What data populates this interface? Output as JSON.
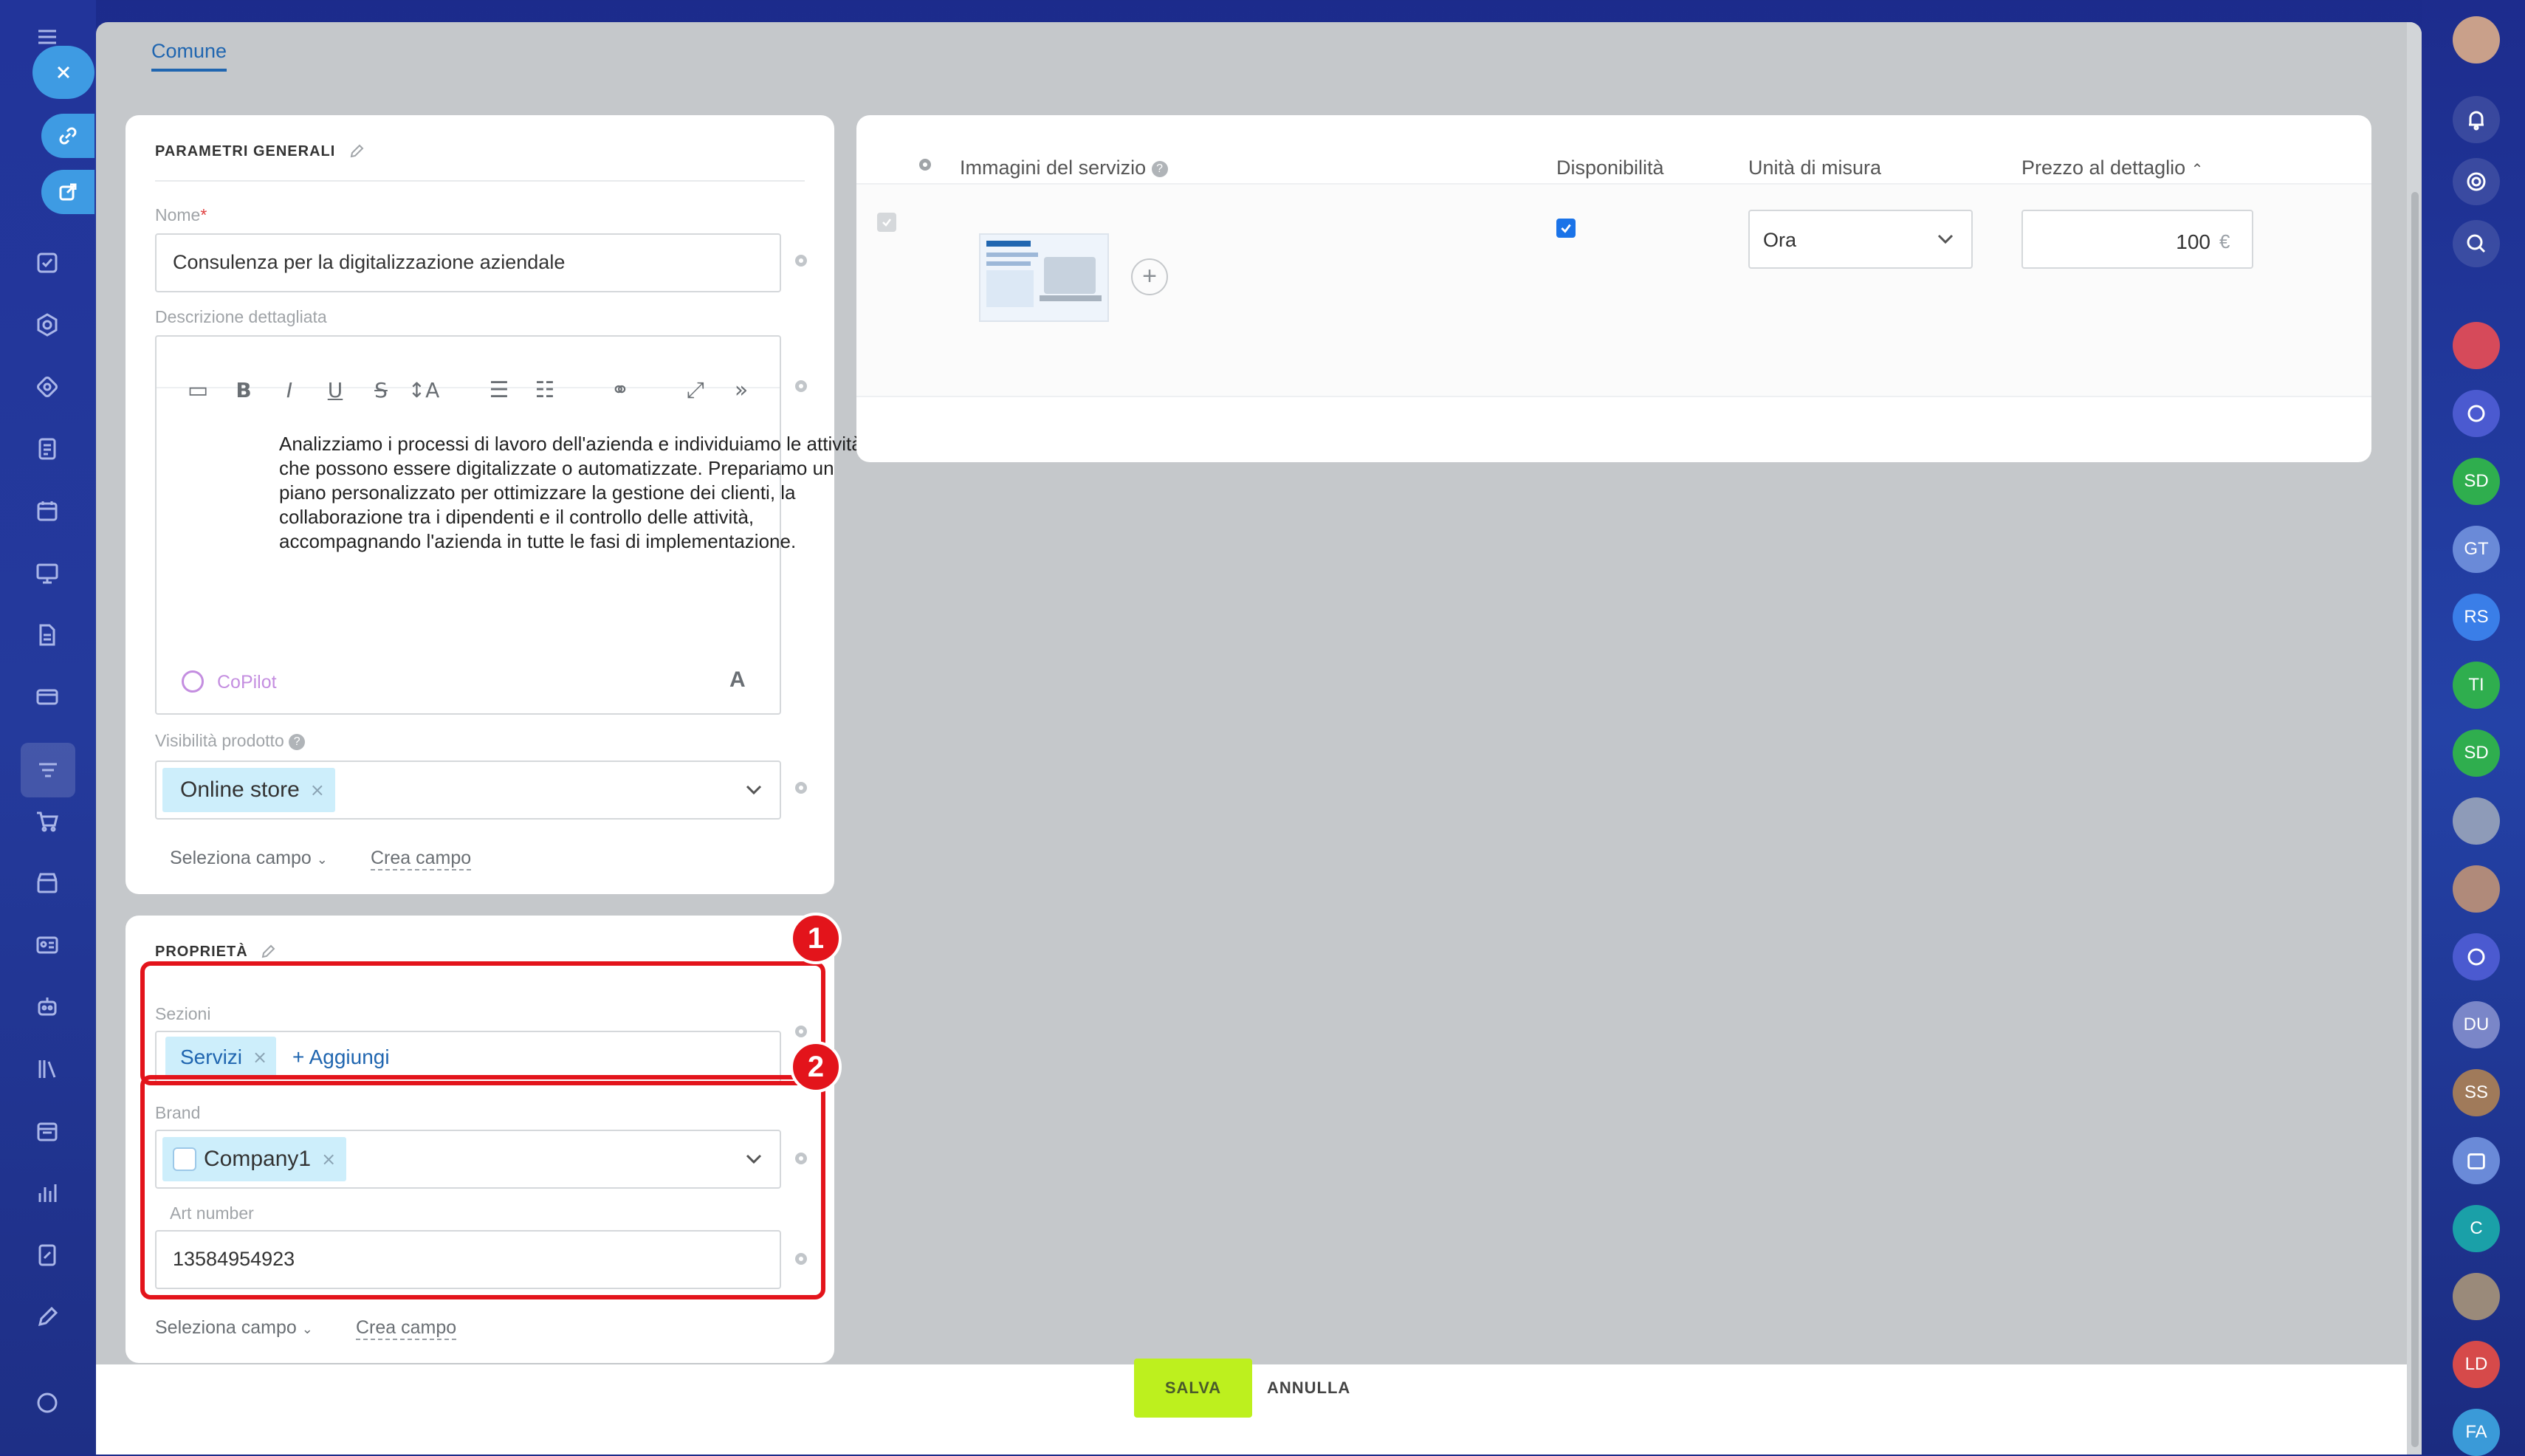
{
  "tabs": [
    {
      "label": "Comune"
    }
  ],
  "general": {
    "title": "PARAMETRI GENERALI",
    "name_label": "Nome",
    "name_value": "Consulenza per la digitalizzazione aziendale",
    "desc_label": "Descrizione dettagliata",
    "desc_text": "Analizziamo i processi di lavoro dell'azienda e individuiamo le attività che possono essere digitalizzate o automatizzate. Prepariamo un piano personalizzato per ottimizzare la gestione dei clienti, la collaborazione tra i dipendenti e il controllo delle attività, accompagnando l'azienda in tutte le fasi di implementazione.",
    "copilot": "CoPilot",
    "visibility_label": "Visibilità prodotto",
    "visibility_chip": "Online store",
    "select_field": "Seleziona campo",
    "create_field": "Crea campo"
  },
  "properties": {
    "title": "PROPRIETÀ",
    "sections_label": "Sezioni",
    "sections_chip": "Servizi",
    "add_link": "+ Aggiungi",
    "brand_label": "Brand",
    "brand_chip": "Company1",
    "art_label": "Art number",
    "art_value": "13584954923",
    "select_field": "Seleziona campo",
    "create_field": "Crea campo"
  },
  "callouts": [
    "1",
    "2"
  ],
  "table": {
    "col_images": "Immagini del servizio",
    "col_availability": "Disponibilità",
    "col_unit": "Unità di misura",
    "col_price": "Prezzo al dettaglio",
    "unit_value": "Ora",
    "price_value": "100",
    "currency": "€",
    "available": true
  },
  "actions": {
    "save": "SALVA",
    "cancel": "ANNULLA"
  },
  "right_avatars": [
    "SD",
    "GT",
    "RS",
    "TI",
    "SD",
    "DU",
    "SS",
    "C",
    "LD",
    "FA"
  ],
  "colors": {
    "accent": "#2066b0",
    "save": "#bdf01e",
    "callout": "#e3141b",
    "chip": "#cdeefb"
  }
}
